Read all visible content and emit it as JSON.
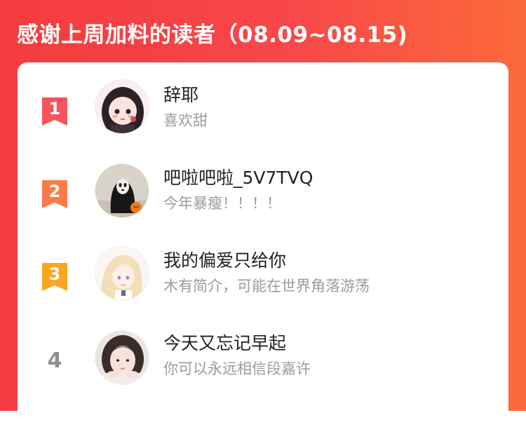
{
  "header": {
    "title": "感谢上周加料的读者（08.09~08.15)"
  },
  "colors": {
    "banner_gradient": [
      "#f53b3e",
      "#fb6a3a"
    ],
    "rank1": "#f4545c",
    "rank2": "#fb7b48",
    "rank3": "#fca521",
    "rank_plain": "#8e8e8e"
  },
  "readers": [
    {
      "rank": "1",
      "name": "辞耶",
      "desc": "喜欢甜",
      "avatar": "anime-girl-avatar"
    },
    {
      "rank": "2",
      "name": "吧啦吧啦_5V7TVQ",
      "desc": "今年暴瘦！！！！",
      "avatar": "masked-figure-avatar"
    },
    {
      "rank": "3",
      "name": "我的偏爱只给你",
      "desc": "木有简介，可能在世界角落游荡",
      "avatar": "illustrated-girl-avatar"
    },
    {
      "rank": "4",
      "name": "今天又忘记早起",
      "desc": "你可以永远相信段嘉许",
      "avatar": "photo-girl-avatar"
    }
  ]
}
